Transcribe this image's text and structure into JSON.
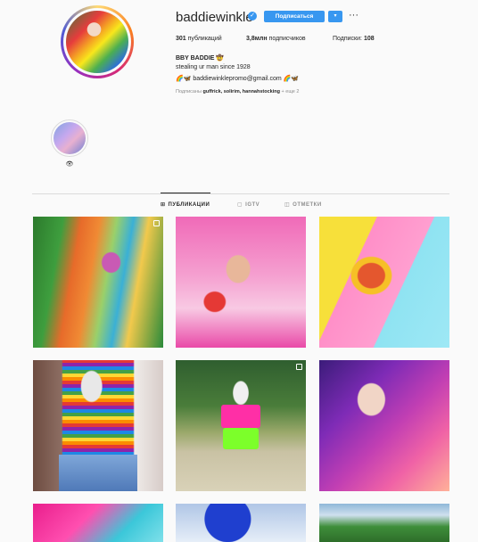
{
  "profile": {
    "username": "baddiewinkle",
    "follow_label": "Подписаться",
    "more_label": "···",
    "dropdown_label": "▾",
    "verified_mark": "✓"
  },
  "stats": {
    "posts_count": "301",
    "posts_label": "публикаций",
    "followers_count": "3,8млн",
    "followers_label": "подписчиков",
    "following_label": "Подписки:",
    "following_count": "108"
  },
  "bio": {
    "name": "BBY BADDIE 🤠",
    "line1": "stealing ur man since 1928",
    "line2": "🌈🦋 baddiewinklepromo@gmail.com 🌈🦋"
  },
  "followed_by": {
    "prefix": "Подписаны",
    "users": "guffrick, solirim, hannahstocking",
    "suffix": "+ еще 2"
  },
  "highlights": [
    {
      "label": "👁"
    }
  ],
  "tabs": [
    {
      "icon": "⊞",
      "label": "ПУБЛИКАЦИИ",
      "active": true
    },
    {
      "icon": "▢",
      "label": "IGTV",
      "active": false
    },
    {
      "icon": "◫",
      "label": "ОТМЕТКИ",
      "active": false
    }
  ],
  "colors": {
    "accent": "#3897f0",
    "text": "#262626",
    "muted": "#8e8e8e",
    "border": "#dbdbdb",
    "background": "#fafafa"
  },
  "icons": {
    "grid": "grid-icon",
    "igtv": "igtv-icon",
    "tagged": "tagged-icon",
    "multi": "multiple-photos-icon"
  }
}
